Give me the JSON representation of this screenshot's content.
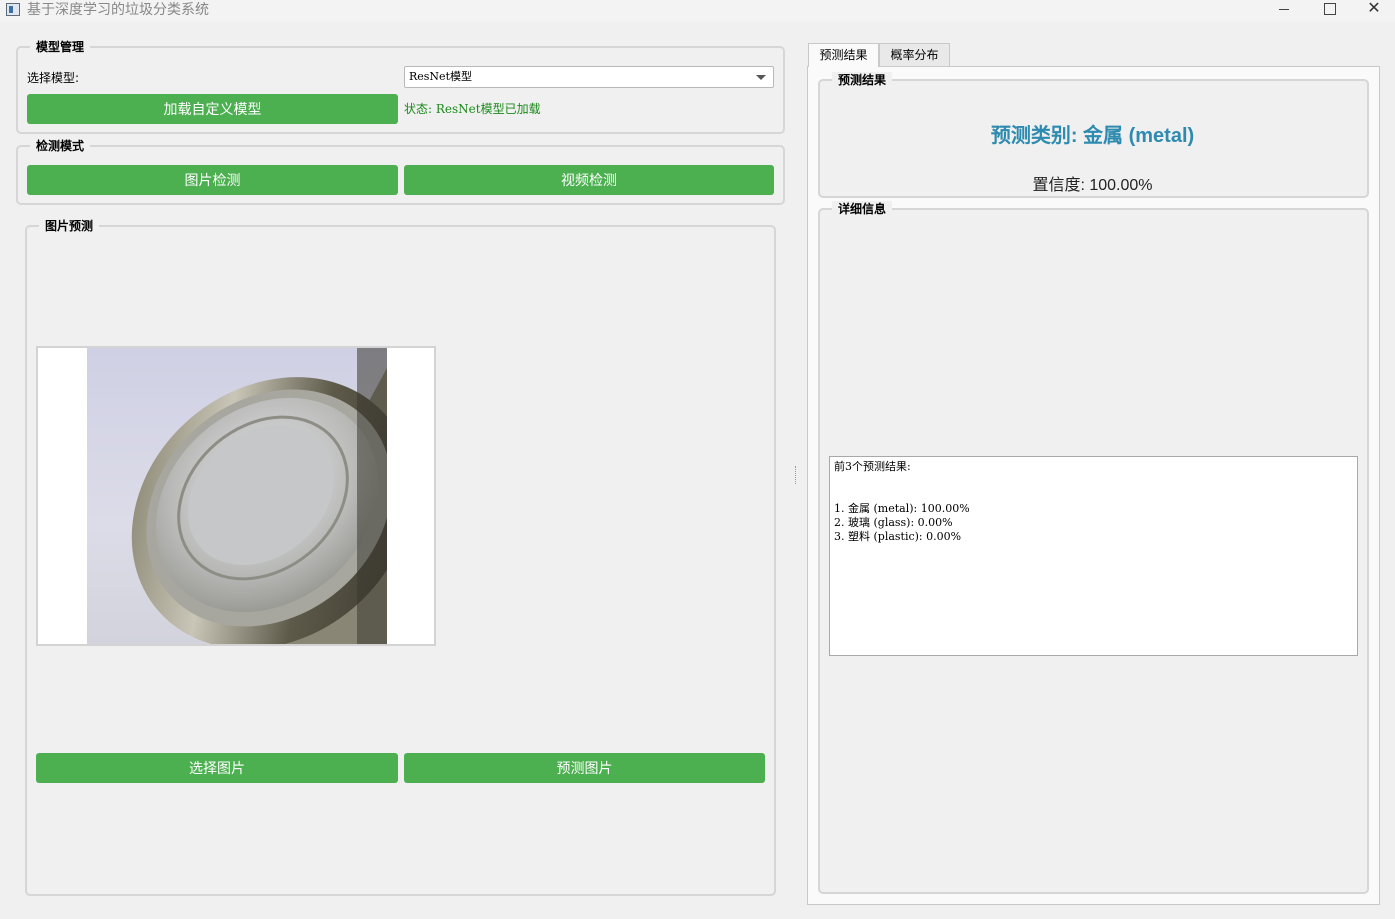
{
  "window": {
    "title": "基于深度学习的垃圾分类系统",
    "controls": {
      "minimize": "",
      "maximize": "",
      "close": "✕"
    }
  },
  "model_group": {
    "title": "模型管理",
    "select_label": "选择模型:",
    "selected_model": "ResNet模型",
    "load_button": "加载自定义模型",
    "status": "状态: ResNet模型已加载"
  },
  "mode_group": {
    "title": "检测模式",
    "image_button": "图片检测",
    "video_button": "视频检测"
  },
  "image_group": {
    "title": "图片预测",
    "select_button": "选择图片",
    "predict_button": "预测图片"
  },
  "tabs": [
    {
      "label": "预测结果",
      "active": true
    },
    {
      "label": "概率分布",
      "active": false
    }
  ],
  "result_group": {
    "title": "预测结果",
    "predicted_class": "预测类别: 金属 (metal)",
    "confidence": "置信度: 100.00%"
  },
  "detail_group": {
    "title": "详细信息",
    "header": "前3个预测结果:",
    "items": [
      "1. 金属 (metal): 100.00%",
      "2. 玻璃 (glass): 0.00%",
      "3. 塑料 (plastic): 0.00%"
    ]
  },
  "colors": {
    "button_green": "#4caf50",
    "status_green": "#1a8a1a",
    "prediction_blue": "#2e8bb0"
  }
}
